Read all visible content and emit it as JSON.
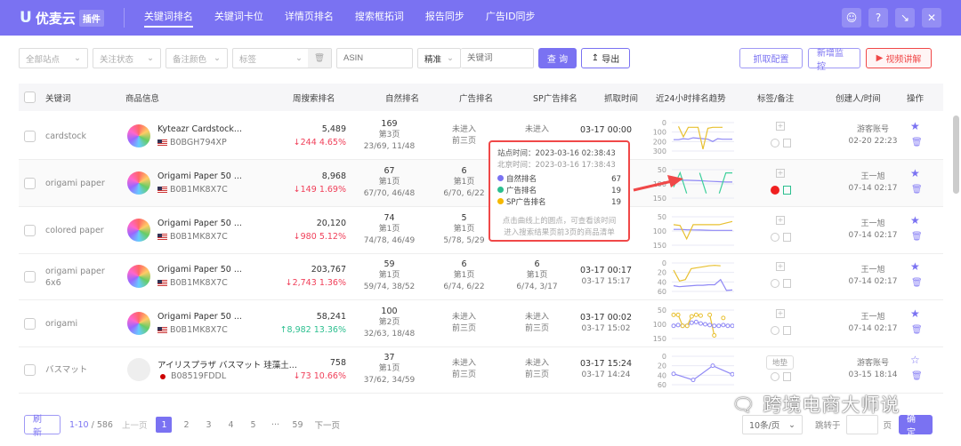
{
  "header": {
    "logo": "优麦云",
    "logo_tag": "插件",
    "nav": [
      "关键词排名",
      "关键词卡位",
      "详情页排名",
      "搜索框拓词",
      "报告同步",
      "广告ID同步"
    ],
    "active": 0
  },
  "filters": {
    "site": "全部站点",
    "follow": "关注状态",
    "note_color": "备注颜色",
    "tag": "标签",
    "asin_placeholder": "ASIN",
    "match": "精准",
    "keyword_placeholder": "关键词",
    "query": "查 询",
    "export": "导出",
    "crawl_config": "抓取配置",
    "add_monitor": "新增监控",
    "video": "视频讲解"
  },
  "columns": [
    "关键词",
    "商品信息",
    "周搜索排名",
    "自然排名",
    "广告排名",
    "SP广告排名",
    "抓取时间",
    "近24小时排名趋势",
    "标签/备注",
    "创建人/时间",
    "操作"
  ],
  "rows": [
    {
      "keyword": "cardstock",
      "title": "Kyteazr Cardstock...",
      "asin": "B0BGH794XP",
      "flag": "us",
      "weekly": "5,489",
      "change": "244",
      "pct": "4.65%",
      "dir": "down",
      "nat": [
        "169",
        "第3页",
        "23/69, 11/48"
      ],
      "ad": [
        "未进入",
        "前三页"
      ],
      "sp": [
        "未进入",
        ""
      ],
      "time": [
        "03-17 00:00",
        ""
      ],
      "tag": "",
      "creator": [
        "游客账号",
        "02-20 22:23"
      ],
      "starred": true,
      "axis": [
        "0",
        "100",
        "200",
        "300"
      ],
      "series": {
        "nat": [
          180,
          180,
          170,
          175,
          160,
          165,
          170,
          175,
          200,
          170,
          175,
          175,
          175
        ],
        "sp": [
          null,
          40,
          150,
          50,
          50,
          50,
          280,
          60,
          50,
          50,
          50,
          null,
          null
        ]
      },
      "ymax": 300,
      "dot": "none"
    },
    {
      "keyword": "origami paper",
      "title": "Origami Paper 50 ...",
      "asin": "B0B1MK8X7C",
      "flag": "us",
      "weekly": "8,968",
      "change": "149",
      "pct": "1.69%",
      "dir": "down",
      "nat": [
        "67",
        "第1页",
        "67/70, 46/48"
      ],
      "ad": [
        "6",
        "第1页",
        "6/70, 6/22"
      ],
      "sp": [
        "",
        ""
      ],
      "time": [
        "",
        ""
      ],
      "tag": "",
      "creator": [
        "王一旭",
        "07-14 02:17"
      ],
      "starred": true,
      "axis": [
        "50",
        "100",
        "150"
      ],
      "series": {
        "nat": [
          null,
          67,
          67,
          68,
          70,
          72,
          74,
          76,
          78,
          78
        ],
        "ad": [
          110,
          19,
          150,
          null,
          20,
          150,
          null,
          150,
          20,
          20
        ]
      },
      "ymax": 180,
      "dot": "red"
    },
    {
      "keyword": "colored paper",
      "title": "Origami Paper 50 ...",
      "asin": "B0B1MK8X7C",
      "flag": "us",
      "weekly": "20,120",
      "change": "980",
      "pct": "5.12%",
      "dir": "down",
      "nat": [
        "74",
        "第1页",
        "74/78, 46/49"
      ],
      "ad": [
        "5",
        "第1页",
        "5/78, 5/29"
      ],
      "sp": [
        "",
        ""
      ],
      "time": [
        "",
        ""
      ],
      "tag": "",
      "creator": [
        "王一旭",
        "07-14 02:17"
      ],
      "starred": true,
      "axis": [
        "50",
        "100",
        "150"
      ],
      "series": {
        "nat": [
          80,
          80,
          82,
          83,
          84,
          85,
          86,
          86,
          86,
          86
        ],
        "sp": [
          50,
          55,
          140,
          50,
          50,
          50,
          50,
          50,
          40,
          30
        ]
      },
      "ymax": 180,
      "dot": "none"
    },
    {
      "keyword": "origami paper 6x6",
      "title": "Origami Paper 50 ...",
      "asin": "B0B1MK8X7C",
      "flag": "us",
      "weekly": "203,767",
      "change": "2,743",
      "pct": "1.36%",
      "dir": "down",
      "nat": [
        "59",
        "第1页",
        "59/74, 38/52"
      ],
      "ad": [
        "6",
        "第1页",
        "6/74, 6/22"
      ],
      "sp": [
        "6",
        "第1页",
        "6/74, 3/17"
      ],
      "time": [
        "03-17 00:17",
        "03-17 15:17"
      ],
      "tag": "",
      "creator": [
        "王一旭",
        "07-14 02:17"
      ],
      "starred": true,
      "axis": [
        "0",
        "20",
        "40",
        "60"
      ],
      "series": {
        "nat": [
          48,
          50,
          49,
          48,
          47,
          47,
          46,
          46,
          35,
          58,
          57
        ],
        "sp": [
          15,
          38,
          35,
          12,
          10,
          8,
          6,
          5,
          6,
          null,
          5
        ]
      },
      "ymax": 60,
      "dot": "none"
    },
    {
      "keyword": "origami",
      "title": "Origami Paper 50 ...",
      "asin": "B0B1MK8X7C",
      "flag": "us",
      "weekly": "58,241",
      "change": "8,982",
      "pct": "13.36%",
      "dir": "up",
      "nat": [
        "100",
        "第2页",
        "32/63, 18/48"
      ],
      "ad": [
        "未进入",
        "前三页"
      ],
      "sp": [
        "未进入",
        "前三页"
      ],
      "time": [
        "03-17 00:02",
        "03-17 15:02"
      ],
      "tag": "",
      "creator": [
        "王一旭",
        "07-14 02:17"
      ],
      "starred": true,
      "axis": [
        "50",
        "100",
        "150"
      ],
      "series": {
        "nat": [
          100,
          95,
          100,
          100,
          80,
          75,
          85,
          90,
          95,
          100,
          100,
          95,
          100,
          100
        ],
        "sp": [
          30,
          30,
          100,
          100,
          40,
          30,
          35,
          null,
          30,
          160,
          null,
          50,
          null,
          null
        ]
      },
      "ymax": 180,
      "dot": "none",
      "markers": true
    },
    {
      "keyword": "バスマット",
      "title": "アイリスプラザ バスマット 珪藻土...",
      "asin": "B08519FDDL",
      "flag": "jp",
      "weekly": "758",
      "change": "73",
      "pct": "10.66%",
      "dir": "down",
      "nat": [
        "37",
        "第1页",
        "37/62, 34/59"
      ],
      "ad": [
        "未进入",
        "前三页"
      ],
      "sp": [
        "未进入",
        "前三页"
      ],
      "time": [
        "03-17 15:24",
        "03-17 14:24"
      ],
      "tag": "地垫",
      "creator": [
        "游客账号",
        "03-15 18:14"
      ],
      "starred": false,
      "axis": [
        "0",
        "20",
        "40",
        "60"
      ],
      "series": {
        "nat": [
          37,
          50,
          20,
          38
        ]
      },
      "ymax": 60,
      "dot": "none",
      "markers": true
    }
  ],
  "tooltip": {
    "site_time": "站点时间：2023-03-16 02:38:43",
    "bj_time": "北京时间：2023-03-16 17:38:43",
    "items": [
      {
        "label": "自然排名",
        "value": "67",
        "color": "#7a72f2"
      },
      {
        "label": "广告排名",
        "value": "19",
        "color": "#2cbf8f"
      },
      {
        "label": "SP广告排名",
        "value": "19",
        "color": "#f5b800"
      }
    ],
    "hint1": "点击曲线上的圆点，可查看该时间",
    "hint2": "进入搜索结果页前3页的商品清单"
  },
  "footer": {
    "refresh": "刷 新",
    "range": "1-10",
    "total": "/ 586",
    "prev": "上一页",
    "pages": [
      "1",
      "2",
      "3",
      "4",
      "5",
      "···",
      "59"
    ],
    "next": "下一页",
    "per_page": "10条/页",
    "jump": "跳转于",
    "page_unit": "页",
    "confirm": "确 定"
  },
  "watermark": "跨境电商大师说",
  "colors": {
    "brand": "#7a72f2",
    "down": "#f0405a",
    "up": "#2cbf8f",
    "sp": "#f5b800",
    "video": "#f04848"
  }
}
